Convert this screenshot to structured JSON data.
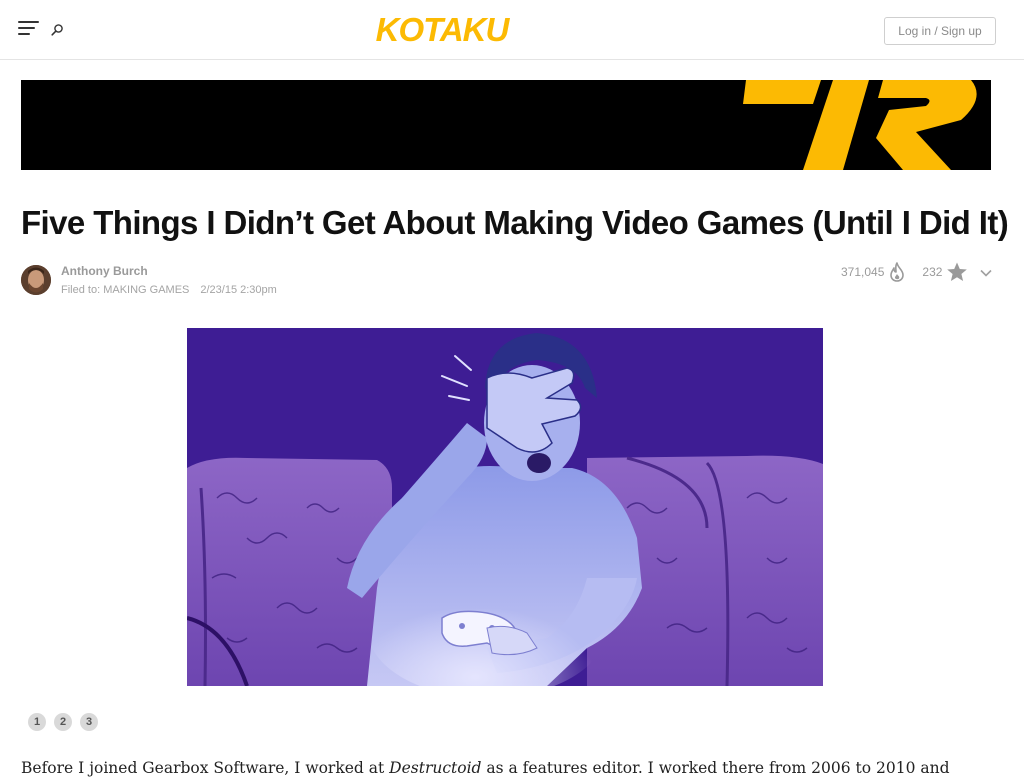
{
  "header": {
    "logo_text": "KOTAKU",
    "login_label": "Log in / Sign up",
    "menu_icon": "hamburger-icon",
    "search_icon": "search-icon"
  },
  "colors": {
    "brand_yellow": "#fcba03",
    "banner_bg": "#000000",
    "illustration_bg": "#3e1d94"
  },
  "article": {
    "title": "Five Things I Didn’t Get About Making Video Games (Until I Did It)",
    "author": "Anthony Burch",
    "filed_prefix": "Filed to: ",
    "category": "MAKING GAMES",
    "date": "2/23/15 2:30pm",
    "views": "371,045",
    "likes": "232",
    "pages": [
      "1",
      "2",
      "3"
    ],
    "intro_before": "Before I joined Gearbox Software, I worked at ",
    "intro_italic": "Destructoid",
    "intro_after": " as a features editor. I worked there from 2006 to 2010 and"
  }
}
